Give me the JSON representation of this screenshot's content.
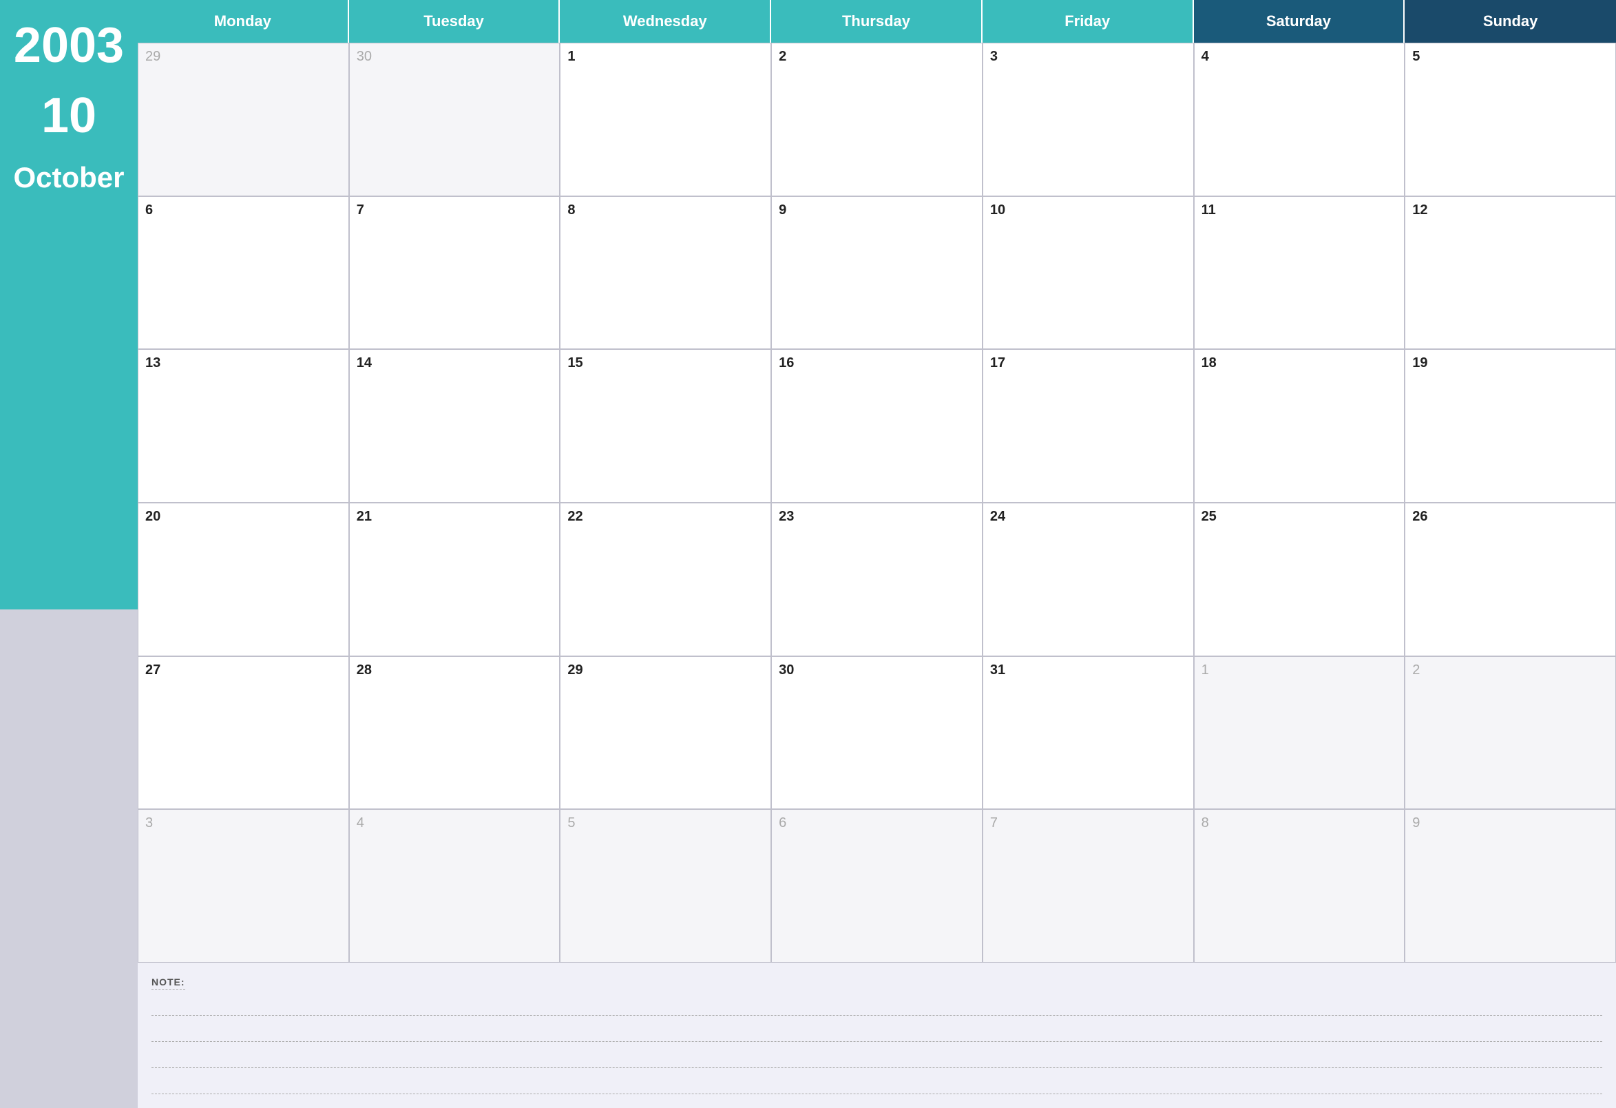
{
  "sidebar": {
    "year": "2003",
    "week": "10",
    "month": "October"
  },
  "header": {
    "days": [
      {
        "label": "Monday",
        "style": "normal"
      },
      {
        "label": "Tuesday",
        "style": "normal"
      },
      {
        "label": "Wednesday",
        "style": "normal"
      },
      {
        "label": "Thursday",
        "style": "normal"
      },
      {
        "label": "Friday",
        "style": "normal"
      },
      {
        "label": "Saturday",
        "style": "dark"
      },
      {
        "label": "Sunday",
        "style": "dark"
      }
    ]
  },
  "grid": [
    [
      {
        "num": "29",
        "other": true
      },
      {
        "num": "30",
        "other": true
      },
      {
        "num": "1",
        "other": false
      },
      {
        "num": "2",
        "other": false
      },
      {
        "num": "3",
        "other": false
      },
      {
        "num": "4",
        "other": false
      },
      {
        "num": "5",
        "other": false
      }
    ],
    [
      {
        "num": "6",
        "other": false
      },
      {
        "num": "7",
        "other": false
      },
      {
        "num": "8",
        "other": false
      },
      {
        "num": "9",
        "other": false
      },
      {
        "num": "10",
        "other": false
      },
      {
        "num": "11",
        "other": false
      },
      {
        "num": "12",
        "other": false
      }
    ],
    [
      {
        "num": "13",
        "other": false
      },
      {
        "num": "14",
        "other": false
      },
      {
        "num": "15",
        "other": false
      },
      {
        "num": "16",
        "other": false
      },
      {
        "num": "17",
        "other": false
      },
      {
        "num": "18",
        "other": false
      },
      {
        "num": "19",
        "other": false
      }
    ],
    [
      {
        "num": "20",
        "other": false
      },
      {
        "num": "21",
        "other": false
      },
      {
        "num": "22",
        "other": false
      },
      {
        "num": "23",
        "other": false
      },
      {
        "num": "24",
        "other": false
      },
      {
        "num": "25",
        "other": false
      },
      {
        "num": "26",
        "other": false
      }
    ],
    [
      {
        "num": "27",
        "other": false
      },
      {
        "num": "28",
        "other": false
      },
      {
        "num": "29",
        "other": false
      },
      {
        "num": "30",
        "other": false
      },
      {
        "num": "31",
        "other": false
      },
      {
        "num": "1",
        "other": true
      },
      {
        "num": "2",
        "other": true
      }
    ],
    [
      {
        "num": "3",
        "other": true
      },
      {
        "num": "4",
        "other": true
      },
      {
        "num": "5",
        "other": true
      },
      {
        "num": "6",
        "other": true
      },
      {
        "num": "7",
        "other": true
      },
      {
        "num": "8",
        "other": true
      },
      {
        "num": "9",
        "other": true
      }
    ]
  ],
  "notes": {
    "label": "NOTE:",
    "lines": 4
  }
}
